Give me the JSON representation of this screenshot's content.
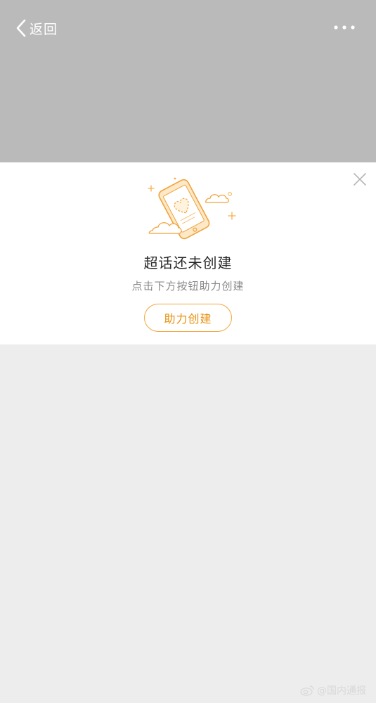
{
  "header": {
    "back_label": "返回",
    "background_color": "#bababa"
  },
  "card": {
    "title": "超话还未创建",
    "subtitle": "点击下方按钮助力创建",
    "action_label": "助力创建",
    "accent_color": "#f2a63b"
  },
  "watermark": {
    "text": "@国内通报"
  },
  "icons": {
    "back": "chevron-left-icon",
    "more": "more-dots-icon",
    "close": "close-icon",
    "illustration": "phone-heart-illustration",
    "weibo": "weibo-logo-icon"
  }
}
